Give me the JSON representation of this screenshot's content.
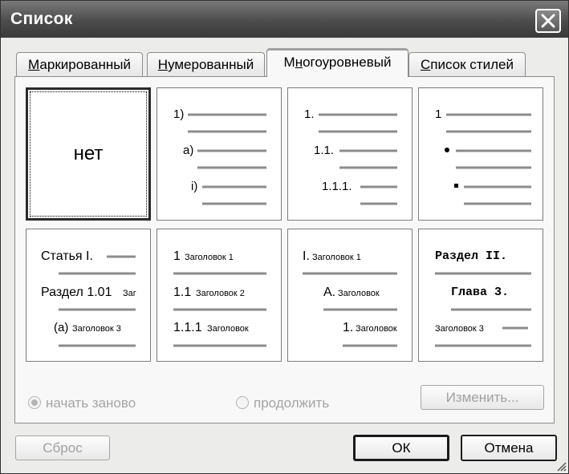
{
  "window": {
    "title": "Список",
    "close_label": "✕"
  },
  "tabs": [
    {
      "label": "Маркированный",
      "underline": "М",
      "rest": "аркированный",
      "active": false
    },
    {
      "label": "Нумерованный",
      "underline": "Н",
      "rest": "умерованный",
      "active": false
    },
    {
      "label": "Многоуровневый",
      "pre": "М",
      "underline": "н",
      "rest": "огоуровневый",
      "active": true
    },
    {
      "label": "Список стилей",
      "underline": "С",
      "rest": "писок стилей",
      "active": false
    }
  ],
  "gallery": {
    "none_label": "нет",
    "cell2": {
      "l1": "1)",
      "l2": "a)",
      "l3": "i)"
    },
    "cell3": {
      "l1": "1.",
      "l2": "1.1.",
      "l3": "1.1.1."
    },
    "cell4": {
      "l1": "1"
    },
    "cell5": {
      "l1": "Статья I.",
      "l2a": "Раздел 1.01",
      "l2b": "Заг",
      "l3a": "(a)",
      "l3b": "Заголовок 3"
    },
    "cell6": {
      "l1a": "1",
      "l1b": "Заголовок 1",
      "l2a": "1.1",
      "l2b": "Заголовок 2",
      "l3a": "1.1.1",
      "l3b": "Заголовок"
    },
    "cell7": {
      "l1a": "I.",
      "l1b": "Заголовок 1",
      "l2a": "A.",
      "l2b": "Заголовок",
      "l3a": "1.",
      "l3b": "Заголовок"
    },
    "cell8": {
      "l1": "Раздел II.",
      "l2": "Глава 3.",
      "l3": "Заголовок 3"
    }
  },
  "options": {
    "restart": {
      "label": "начать заново",
      "checked": true,
      "enabled": false
    },
    "continue": {
      "label": "продолжить",
      "checked": false,
      "enabled": false
    }
  },
  "buttons": {
    "change": "Изменить...",
    "reset": "Сброс",
    "ok": "ОК",
    "cancel": "Отмена"
  },
  "colors": {
    "titlebar": "#4c4c4c",
    "face": "#ececea",
    "line": "#8c8c8c",
    "disabled_text": "#a0a0a0"
  }
}
